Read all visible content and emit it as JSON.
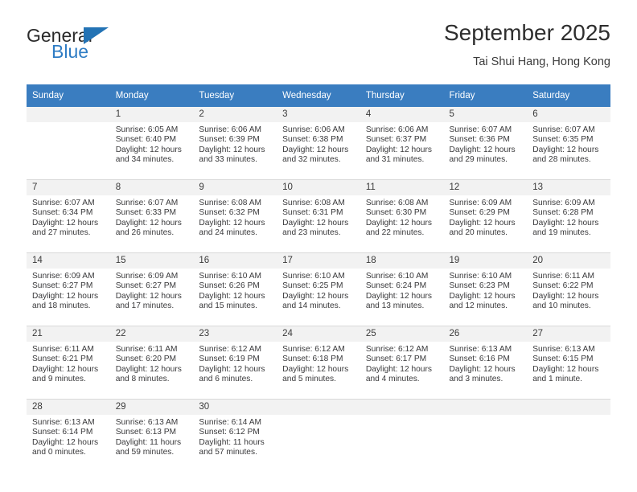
{
  "brand": {
    "name_top": "General",
    "name_bottom": "Blue",
    "triangle_color": "#2373b5",
    "blue_color": "#2e7cc4"
  },
  "header": {
    "title": "September 2025",
    "subtitle": "Tai Shui Hang, Hong Kong"
  },
  "theme": {
    "header_row_bg": "#3a7dc0",
    "daynum_bg": "#f2f2f2",
    "text": "#39393b",
    "grid_line": "#d9d9d9"
  },
  "weekdays": [
    "Sunday",
    "Monday",
    "Tuesday",
    "Wednesday",
    "Thursday",
    "Friday",
    "Saturday"
  ],
  "weeks": [
    [
      {
        "day": "",
        "sunrise": "",
        "sunset": "",
        "daylight_1": "",
        "daylight_2": ""
      },
      {
        "day": "1",
        "sunrise": "Sunrise: 6:05 AM",
        "sunset": "Sunset: 6:40 PM",
        "daylight_1": "Daylight: 12 hours",
        "daylight_2": "and 34 minutes."
      },
      {
        "day": "2",
        "sunrise": "Sunrise: 6:06 AM",
        "sunset": "Sunset: 6:39 PM",
        "daylight_1": "Daylight: 12 hours",
        "daylight_2": "and 33 minutes."
      },
      {
        "day": "3",
        "sunrise": "Sunrise: 6:06 AM",
        "sunset": "Sunset: 6:38 PM",
        "daylight_1": "Daylight: 12 hours",
        "daylight_2": "and 32 minutes."
      },
      {
        "day": "4",
        "sunrise": "Sunrise: 6:06 AM",
        "sunset": "Sunset: 6:37 PM",
        "daylight_1": "Daylight: 12 hours",
        "daylight_2": "and 31 minutes."
      },
      {
        "day": "5",
        "sunrise": "Sunrise: 6:07 AM",
        "sunset": "Sunset: 6:36 PM",
        "daylight_1": "Daylight: 12 hours",
        "daylight_2": "and 29 minutes."
      },
      {
        "day": "6",
        "sunrise": "Sunrise: 6:07 AM",
        "sunset": "Sunset: 6:35 PM",
        "daylight_1": "Daylight: 12 hours",
        "daylight_2": "and 28 minutes."
      }
    ],
    [
      {
        "day": "7",
        "sunrise": "Sunrise: 6:07 AM",
        "sunset": "Sunset: 6:34 PM",
        "daylight_1": "Daylight: 12 hours",
        "daylight_2": "and 27 minutes."
      },
      {
        "day": "8",
        "sunrise": "Sunrise: 6:07 AM",
        "sunset": "Sunset: 6:33 PM",
        "daylight_1": "Daylight: 12 hours",
        "daylight_2": "and 26 minutes."
      },
      {
        "day": "9",
        "sunrise": "Sunrise: 6:08 AM",
        "sunset": "Sunset: 6:32 PM",
        "daylight_1": "Daylight: 12 hours",
        "daylight_2": "and 24 minutes."
      },
      {
        "day": "10",
        "sunrise": "Sunrise: 6:08 AM",
        "sunset": "Sunset: 6:31 PM",
        "daylight_1": "Daylight: 12 hours",
        "daylight_2": "and 23 minutes."
      },
      {
        "day": "11",
        "sunrise": "Sunrise: 6:08 AM",
        "sunset": "Sunset: 6:30 PM",
        "daylight_1": "Daylight: 12 hours",
        "daylight_2": "and 22 minutes."
      },
      {
        "day": "12",
        "sunrise": "Sunrise: 6:09 AM",
        "sunset": "Sunset: 6:29 PM",
        "daylight_1": "Daylight: 12 hours",
        "daylight_2": "and 20 minutes."
      },
      {
        "day": "13",
        "sunrise": "Sunrise: 6:09 AM",
        "sunset": "Sunset: 6:28 PM",
        "daylight_1": "Daylight: 12 hours",
        "daylight_2": "and 19 minutes."
      }
    ],
    [
      {
        "day": "14",
        "sunrise": "Sunrise: 6:09 AM",
        "sunset": "Sunset: 6:27 PM",
        "daylight_1": "Daylight: 12 hours",
        "daylight_2": "and 18 minutes."
      },
      {
        "day": "15",
        "sunrise": "Sunrise: 6:09 AM",
        "sunset": "Sunset: 6:27 PM",
        "daylight_1": "Daylight: 12 hours",
        "daylight_2": "and 17 minutes."
      },
      {
        "day": "16",
        "sunrise": "Sunrise: 6:10 AM",
        "sunset": "Sunset: 6:26 PM",
        "daylight_1": "Daylight: 12 hours",
        "daylight_2": "and 15 minutes."
      },
      {
        "day": "17",
        "sunrise": "Sunrise: 6:10 AM",
        "sunset": "Sunset: 6:25 PM",
        "daylight_1": "Daylight: 12 hours",
        "daylight_2": "and 14 minutes."
      },
      {
        "day": "18",
        "sunrise": "Sunrise: 6:10 AM",
        "sunset": "Sunset: 6:24 PM",
        "daylight_1": "Daylight: 12 hours",
        "daylight_2": "and 13 minutes."
      },
      {
        "day": "19",
        "sunrise": "Sunrise: 6:10 AM",
        "sunset": "Sunset: 6:23 PM",
        "daylight_1": "Daylight: 12 hours",
        "daylight_2": "and 12 minutes."
      },
      {
        "day": "20",
        "sunrise": "Sunrise: 6:11 AM",
        "sunset": "Sunset: 6:22 PM",
        "daylight_1": "Daylight: 12 hours",
        "daylight_2": "and 10 minutes."
      }
    ],
    [
      {
        "day": "21",
        "sunrise": "Sunrise: 6:11 AM",
        "sunset": "Sunset: 6:21 PM",
        "daylight_1": "Daylight: 12 hours",
        "daylight_2": "and 9 minutes."
      },
      {
        "day": "22",
        "sunrise": "Sunrise: 6:11 AM",
        "sunset": "Sunset: 6:20 PM",
        "daylight_1": "Daylight: 12 hours",
        "daylight_2": "and 8 minutes."
      },
      {
        "day": "23",
        "sunrise": "Sunrise: 6:12 AM",
        "sunset": "Sunset: 6:19 PM",
        "daylight_1": "Daylight: 12 hours",
        "daylight_2": "and 6 minutes."
      },
      {
        "day": "24",
        "sunrise": "Sunrise: 6:12 AM",
        "sunset": "Sunset: 6:18 PM",
        "daylight_1": "Daylight: 12 hours",
        "daylight_2": "and 5 minutes."
      },
      {
        "day": "25",
        "sunrise": "Sunrise: 6:12 AM",
        "sunset": "Sunset: 6:17 PM",
        "daylight_1": "Daylight: 12 hours",
        "daylight_2": "and 4 minutes."
      },
      {
        "day": "26",
        "sunrise": "Sunrise: 6:13 AM",
        "sunset": "Sunset: 6:16 PM",
        "daylight_1": "Daylight: 12 hours",
        "daylight_2": "and 3 minutes."
      },
      {
        "day": "27",
        "sunrise": "Sunrise: 6:13 AM",
        "sunset": "Sunset: 6:15 PM",
        "daylight_1": "Daylight: 12 hours",
        "daylight_2": "and 1 minute."
      }
    ],
    [
      {
        "day": "28",
        "sunrise": "Sunrise: 6:13 AM",
        "sunset": "Sunset: 6:14 PM",
        "daylight_1": "Daylight: 12 hours",
        "daylight_2": "and 0 minutes."
      },
      {
        "day": "29",
        "sunrise": "Sunrise: 6:13 AM",
        "sunset": "Sunset: 6:13 PM",
        "daylight_1": "Daylight: 11 hours",
        "daylight_2": "and 59 minutes."
      },
      {
        "day": "30",
        "sunrise": "Sunrise: 6:14 AM",
        "sunset": "Sunset: 6:12 PM",
        "daylight_1": "Daylight: 11 hours",
        "daylight_2": "and 57 minutes."
      },
      {
        "day": "",
        "sunrise": "",
        "sunset": "",
        "daylight_1": "",
        "daylight_2": ""
      },
      {
        "day": "",
        "sunrise": "",
        "sunset": "",
        "daylight_1": "",
        "daylight_2": ""
      },
      {
        "day": "",
        "sunrise": "",
        "sunset": "",
        "daylight_1": "",
        "daylight_2": ""
      },
      {
        "day": "",
        "sunrise": "",
        "sunset": "",
        "daylight_1": "",
        "daylight_2": ""
      }
    ]
  ]
}
